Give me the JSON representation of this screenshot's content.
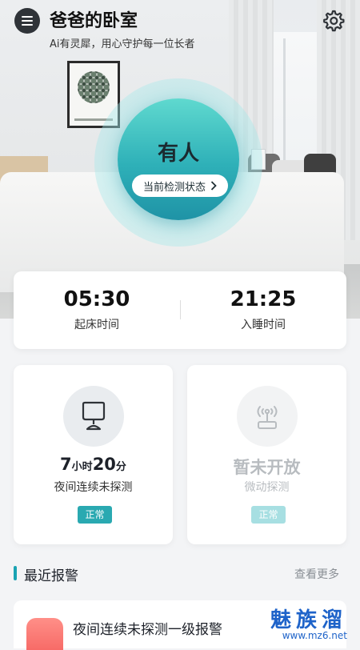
{
  "header": {
    "title": "爸爸的卧室",
    "subtitle": "Ai有灵犀，用心守护每一位长者"
  },
  "status": {
    "value": "有人",
    "button_label": "当前检测状态"
  },
  "times": {
    "wake": {
      "value": "05:30",
      "label": "起床时间"
    },
    "sleep": {
      "value": "21:25",
      "label": "入睡时间"
    }
  },
  "cards": {
    "night": {
      "hours": "7",
      "hours_unit": "小时",
      "minutes": "20",
      "minutes_unit": "分",
      "label": "夜间连续未探测",
      "badge": "正常",
      "badge_color": "#2aa9b1",
      "icon": "lamp-icon"
    },
    "motion": {
      "value": "暂未开放",
      "label": "微动探测",
      "badge": "正常",
      "badge_color": "#a7dfe2",
      "icon": "radar-icon"
    }
  },
  "recent": {
    "title": "最近报警",
    "more": "查看更多",
    "alarm_text": "夜间连续未探测一级报警",
    "alarm_icon": "alarm-light-icon"
  },
  "watermark": {
    "brand": "魅族溜",
    "url": "www.mz6.net"
  },
  "colors": {
    "accent": "#1aa3b3",
    "circle_top": "#5fd9cf",
    "circle_bottom": "#1f93a6"
  }
}
